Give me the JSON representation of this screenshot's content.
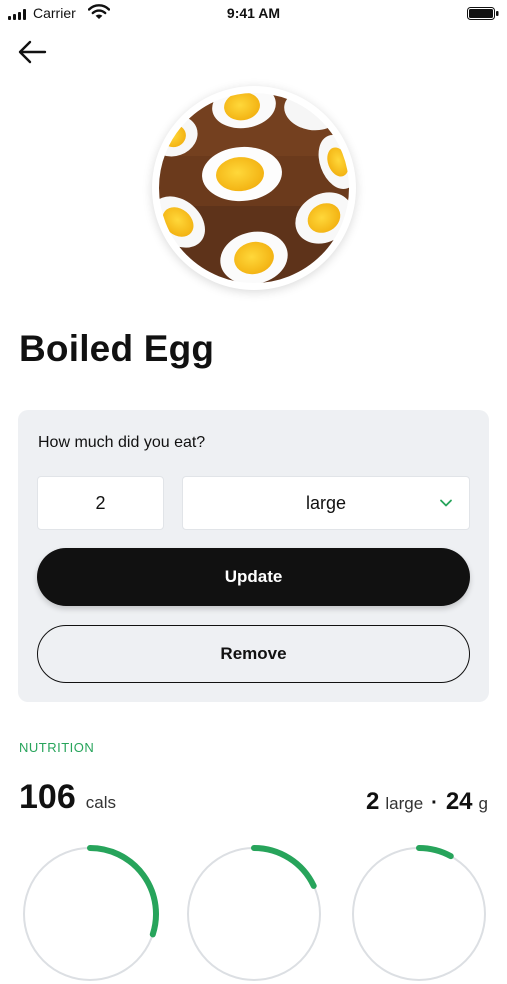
{
  "status_bar": {
    "carrier": "Carrier",
    "time": "9:41 AM"
  },
  "food": {
    "name": "Boiled Egg",
    "image": "boiled-egg-halves-photo"
  },
  "serving_form": {
    "question": "How much did you eat?",
    "quantity": "2",
    "unit": "large",
    "update_label": "Update",
    "remove_label": "Remove"
  },
  "nutrition": {
    "section_label": "NUTRITION",
    "calories": "106",
    "calories_unit": "cals",
    "serving_count": "2",
    "serving_unit": "large",
    "separator": "·",
    "weight": "24",
    "weight_unit": "g",
    "rings": [
      {
        "name": "macro-ring-1",
        "fraction": 0.3
      },
      {
        "name": "macro-ring-2",
        "fraction": 0.18
      },
      {
        "name": "macro-ring-3",
        "fraction": 0.08
      }
    ]
  },
  "colors": {
    "accent_green": "#27a45b",
    "card_bg": "#eef0f3",
    "primary_button": "#111111"
  },
  "icons": {
    "back": "arrow-left-icon",
    "dropdown": "chevron-down-icon",
    "wifi": "wifi-icon",
    "signal": "signal-icon",
    "battery": "battery-icon"
  }
}
